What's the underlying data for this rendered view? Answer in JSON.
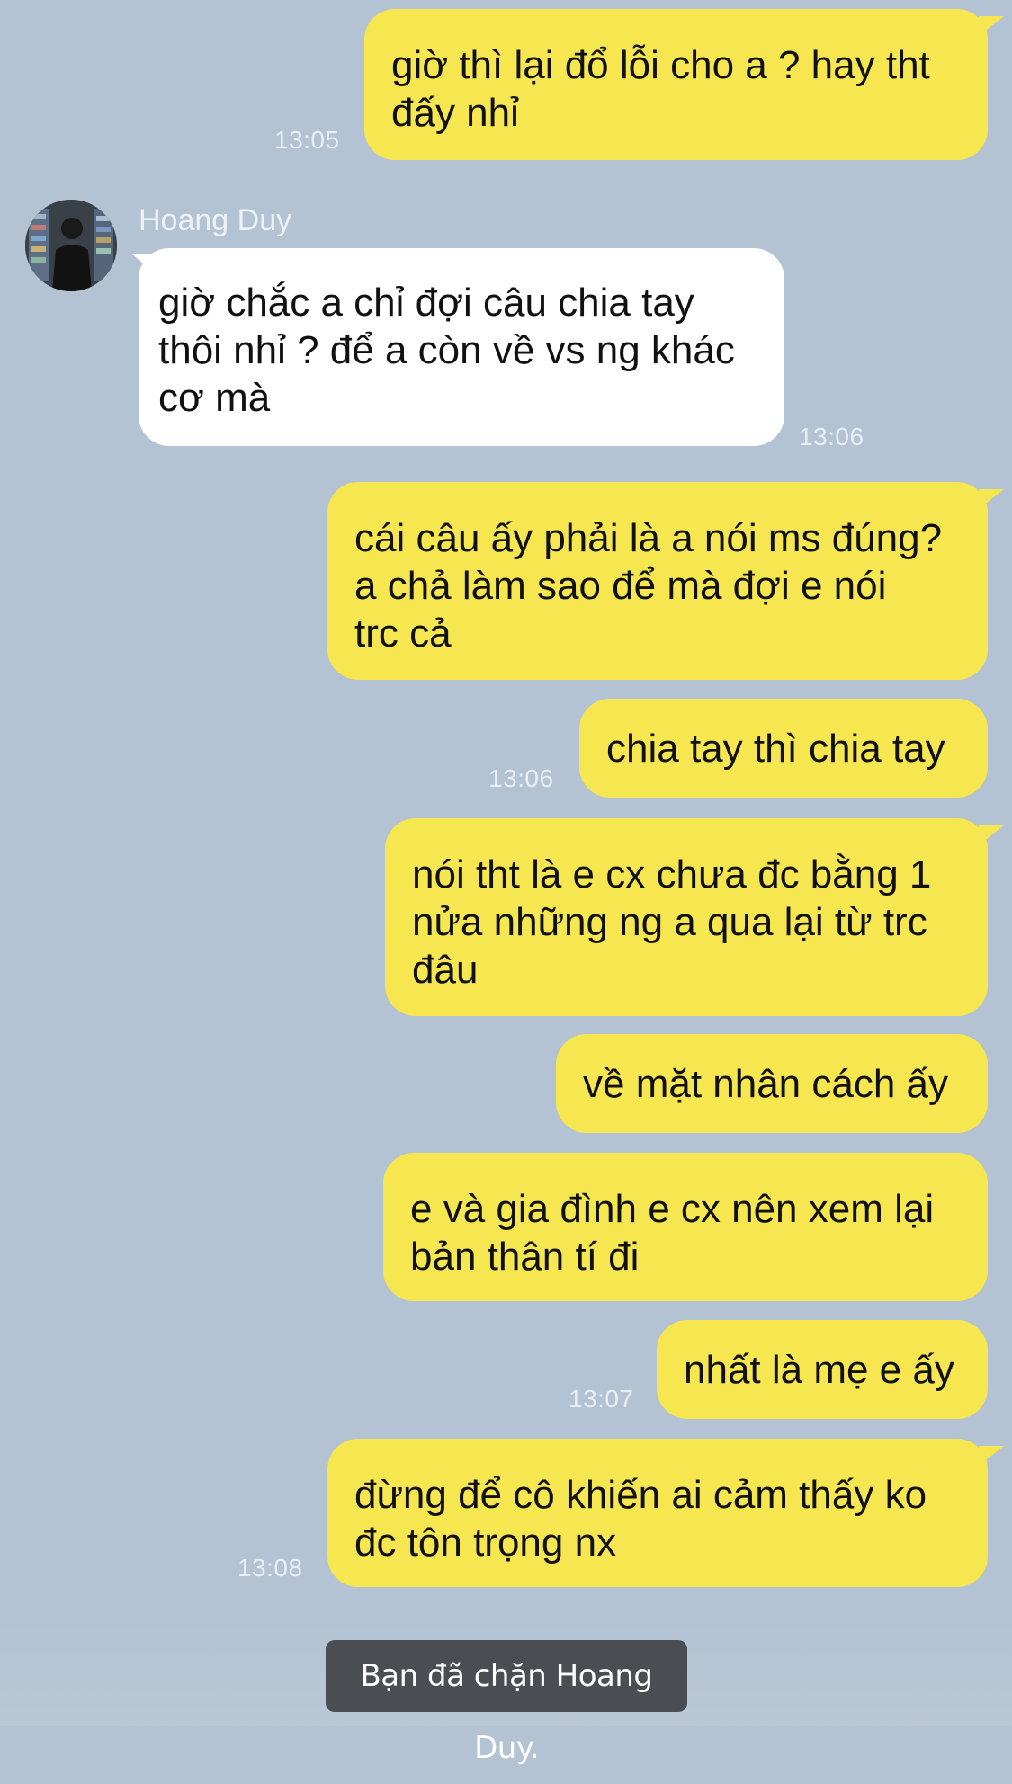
{
  "conversation": {
    "contact_name": "Hoang Duy",
    "messages": [
      {
        "id": "m1",
        "direction": "sent",
        "text": "giờ thì lại đổ lỗi cho a ? hay tht\nđấy nhỉ",
        "time": "13:05"
      },
      {
        "id": "m2",
        "direction": "received",
        "text": "giờ chắc a chỉ đợi câu chia tay\nthôi nhỉ ? để a còn về vs ng khác\ncơ mà",
        "time": "13:06"
      },
      {
        "id": "m3",
        "direction": "sent",
        "text": "cái câu ấy phải là a nói ms đúng?\na chả làm sao để mà đợi e nói\ntrc cả",
        "time": ""
      },
      {
        "id": "m4",
        "direction": "sent",
        "text": "chia tay thì chia tay",
        "time": "13:06"
      },
      {
        "id": "m5",
        "direction": "sent",
        "text": "nói tht là e cx chưa đc bằng 1\nnửa những ng a qua lại từ trc\nđâu",
        "time": ""
      },
      {
        "id": "m6",
        "direction": "sent",
        "text": "về mặt nhân cách ấy",
        "time": ""
      },
      {
        "id": "m7",
        "direction": "sent",
        "text": "e và gia đình e cx nên xem lại\nbản thân tí đi",
        "time": ""
      },
      {
        "id": "m8",
        "direction": "sent",
        "text": "nhất là mẹ e ấy",
        "time": "13:07"
      },
      {
        "id": "m9",
        "direction": "sent",
        "text": "đừng để cô khiến ai cảm thấy ko\nđc tôn trọng nx",
        "time": "13:08"
      }
    ],
    "system_note": "Bạn đã chặn Hoang Duy."
  },
  "colors": {
    "background": "#b3c3d3",
    "sent_bubble": "#f6e64f",
    "received_bubble": "#ffffff",
    "timestamp": "#e8eef5",
    "system_note_bg": "#4a4d52"
  }
}
